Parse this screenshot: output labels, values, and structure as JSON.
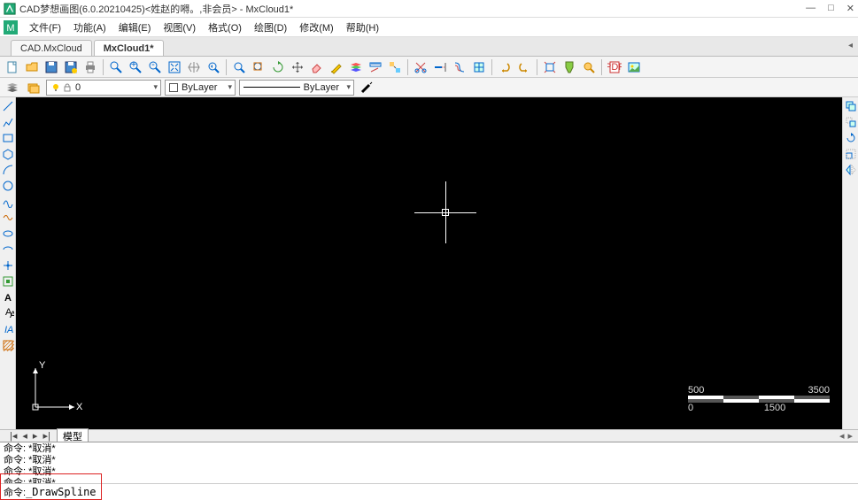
{
  "window": {
    "title": "CAD梦想画图(6.0.20210425)<姓赵的嘚。,非会员> - MxCloud1*",
    "min": "—",
    "max": "□",
    "close": "✕"
  },
  "menu": {
    "items": [
      "文件(F)",
      "功能(A)",
      "编辑(E)",
      "视图(V)",
      "格式(O)",
      "绘图(D)",
      "修改(M)",
      "帮助(H)"
    ]
  },
  "doc_tabs": {
    "items": [
      {
        "label": "CAD.MxCloud",
        "active": false
      },
      {
        "label": "MxCloud1*",
        "active": true
      }
    ]
  },
  "layer_controls": {
    "layer_value": "0",
    "color_value": "ByLayer",
    "linetype_value": "ByLayer"
  },
  "model_tab": {
    "label": "模型"
  },
  "scale": {
    "t0": "500",
    "t1": "3500",
    "b0": "0",
    "b1": "1500"
  },
  "ucs": {
    "x": "X",
    "y": "Y"
  },
  "command": {
    "log": [
      "命令: *取消*",
      "命令: *取消*",
      "命令: *取消*",
      "命令: *取消*"
    ],
    "prompt": "命令:",
    "input_value": "_DrawSpline"
  },
  "icon_names": {
    "left": [
      "line",
      "polyline",
      "rect",
      "polygon",
      "arc",
      "circle",
      "spline",
      "spline2",
      "ellipse",
      "ellipse-arc",
      "point",
      "block",
      "text-a",
      "mtext",
      "iia",
      "hatch"
    ],
    "right": [
      "copy-side",
      "move-side",
      "rotate-side",
      "scale-side",
      "mirror-side"
    ]
  }
}
